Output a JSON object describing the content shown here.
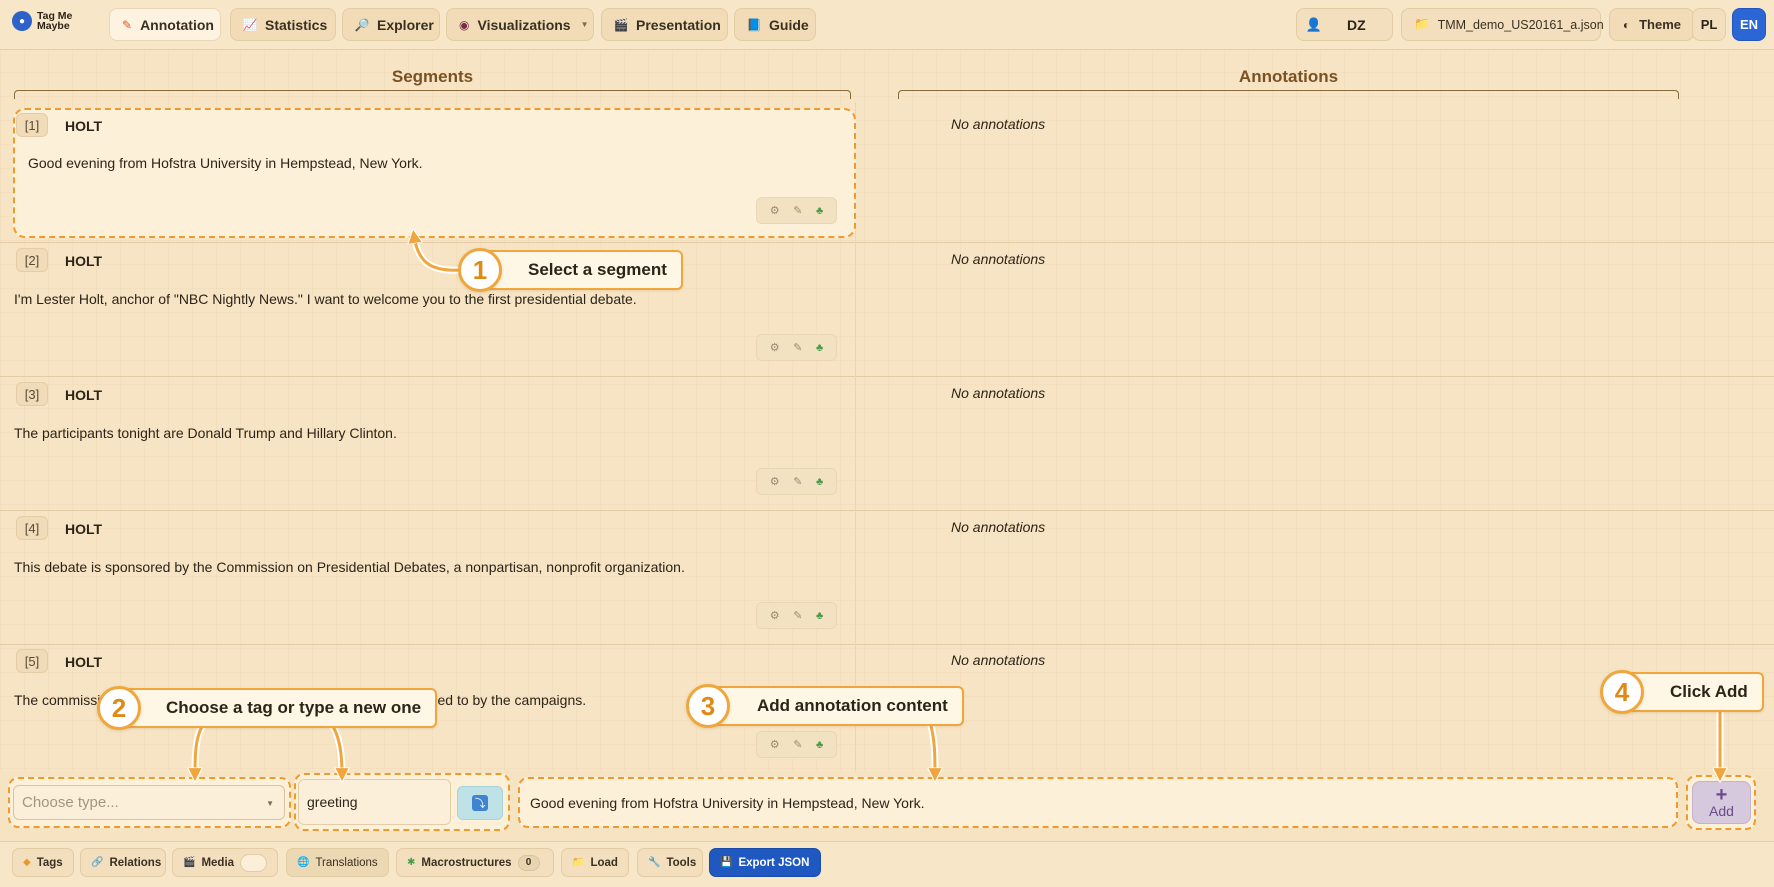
{
  "app": {
    "logo_line1": "Tag Me",
    "logo_line2": "Maybe"
  },
  "nav": {
    "items": [
      {
        "label": "Annotation",
        "icon": "pencil-icon"
      },
      {
        "label": "Statistics",
        "icon": "chart-icon"
      },
      {
        "label": "Explorer",
        "icon": "magnifier-icon"
      },
      {
        "label": "Visualizations",
        "icon": "eye-icon"
      },
      {
        "label": "Presentation",
        "icon": "clapper-icon"
      },
      {
        "label": "Guide",
        "icon": "book-icon"
      }
    ],
    "active": "Annotation"
  },
  "header_right": {
    "user_initials": "DZ",
    "file_name": "TMM_demo_US20161_a.json",
    "theme_label": "Theme",
    "lang_pl": "PL",
    "lang_en": "EN",
    "active_lang": "EN"
  },
  "columns": {
    "segments": "Segments",
    "annotations": "Annotations"
  },
  "segments": [
    {
      "num": "[1]",
      "speaker": "HOLT",
      "text": "Good evening from Hofstra University in Hempstead, New York.",
      "annotations": "No annotations"
    },
    {
      "num": "[2]",
      "speaker": "HOLT",
      "text": "I'm Lester Holt, anchor of \"NBC Nightly News.\" I want to welcome you to the first presidential debate.",
      "annotations": "No annotations"
    },
    {
      "num": "[3]",
      "speaker": "HOLT",
      "text": "The participants tonight are Donald Trump and Hillary Clinton.",
      "annotations": "No annotations"
    },
    {
      "num": "[4]",
      "speaker": "HOLT",
      "text": "This debate is sponsored by the Commission on Presidential Debates, a nonpartisan, nonprofit organization.",
      "annotations": "No annotations"
    },
    {
      "num": "[5]",
      "speaker": "HOLT",
      "text": "The commissi",
      "text_end": "en agreed to by the campaigns.",
      "annotations": "No annotations"
    }
  ],
  "callouts": {
    "step1": {
      "num": "1",
      "label": "Select a segment"
    },
    "step2": {
      "num": "2",
      "label": "Choose a tag or type a new one"
    },
    "step3": {
      "num": "3",
      "label": "Add annotation content"
    },
    "step4": {
      "num": "4",
      "label": "Click Add"
    }
  },
  "form": {
    "type_placeholder": "Choose type...",
    "tag_value": "greeting",
    "content_value": "Good evening from Hofstra University in Hempstead, New York.",
    "add_label": "Add"
  },
  "toolbar": {
    "tags": "Tags",
    "relations": "Relations",
    "media": "Media",
    "translations": "Translations",
    "macrostructures": "Macrostructures",
    "macro_count": "0",
    "load": "Load",
    "tools": "Tools",
    "export": "Export JSON"
  },
  "colors": {
    "accent_orange": "#ef9a2c",
    "primary_blue": "#2a66d6",
    "background": "#f6e4c4"
  }
}
